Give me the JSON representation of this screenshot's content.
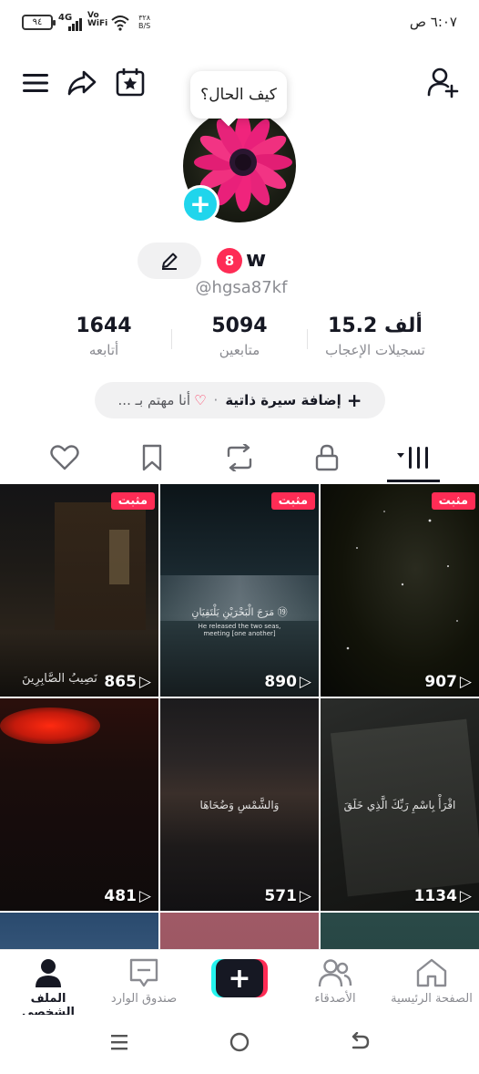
{
  "status_bar": {
    "battery": "٩٤",
    "network": "4G",
    "volte": [
      "Vo",
      "WiFi"
    ],
    "speed": [
      "٣٢٨",
      "B/S"
    ],
    "time": "٦:٠٧ ص"
  },
  "header": {
    "tooltip": "كيف الحال؟"
  },
  "profile": {
    "badge": "8",
    "username": "w",
    "handle": "@hgsa87kf"
  },
  "stats": [
    {
      "value": "1644",
      "label": "أتابعه"
    },
    {
      "value": "5094",
      "label": "متابعين"
    },
    {
      "value": "15.2 ألف",
      "label": "تسجيلات الإعجاب"
    }
  ],
  "bio": {
    "plus": "+",
    "add_label": "إضافة سيرة ذاتية",
    "dot": "·",
    "interest": "أنا مهتم بـ ..."
  },
  "videos": [
    {
      "views": "907",
      "pinned": "مثبت",
      "overlay": ""
    },
    {
      "views": "890",
      "pinned": "مثبت",
      "overlay": "مَرَجَ الْبَحْرَيْنِ يَلْتَقِيَانِ ⑲",
      "overlay2": "He released the two seas, meeting [one another]"
    },
    {
      "views": "865",
      "pinned": "مثبت",
      "overlay": "نَصِيبُ الصَّابِرِينَ"
    },
    {
      "views": "1134",
      "pinned": "",
      "overlay": "اقْرَأْ بِاسْمِ رَبِّكَ الَّذِي خَلَقَ"
    },
    {
      "views": "571",
      "pinned": "",
      "overlay": "وَالشَّمْسِ وَضُحَاهَا"
    },
    {
      "views": "481",
      "pinned": "",
      "overlay": ""
    }
  ],
  "navbar": {
    "home": "الصفحة الرئيسية",
    "friends": "الأصدقاء",
    "create": "+",
    "inbox": "صندوق الوارد",
    "profile": "الملف الشخصي"
  },
  "colors": {
    "accent": "#fe2c55",
    "cyan": "#25f4ee",
    "avatar_plus": "#20d5ec"
  }
}
